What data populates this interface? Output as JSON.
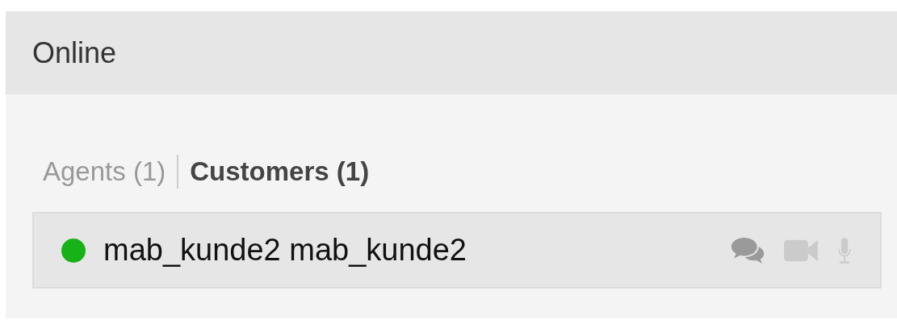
{
  "panel": {
    "title": "Online"
  },
  "tabs": [
    {
      "label": "Agents (1)",
      "selected": false
    },
    {
      "label": "Customers (1)",
      "selected": true
    }
  ],
  "users": [
    {
      "name": "mab_kunde2 mab_kunde2",
      "color": "#17b217",
      "actions": [
        {
          "kind": "chat",
          "enabled": true
        },
        {
          "kind": "video",
          "enabled": false
        },
        {
          "kind": "audio",
          "enabled": false
        }
      ]
    }
  ]
}
